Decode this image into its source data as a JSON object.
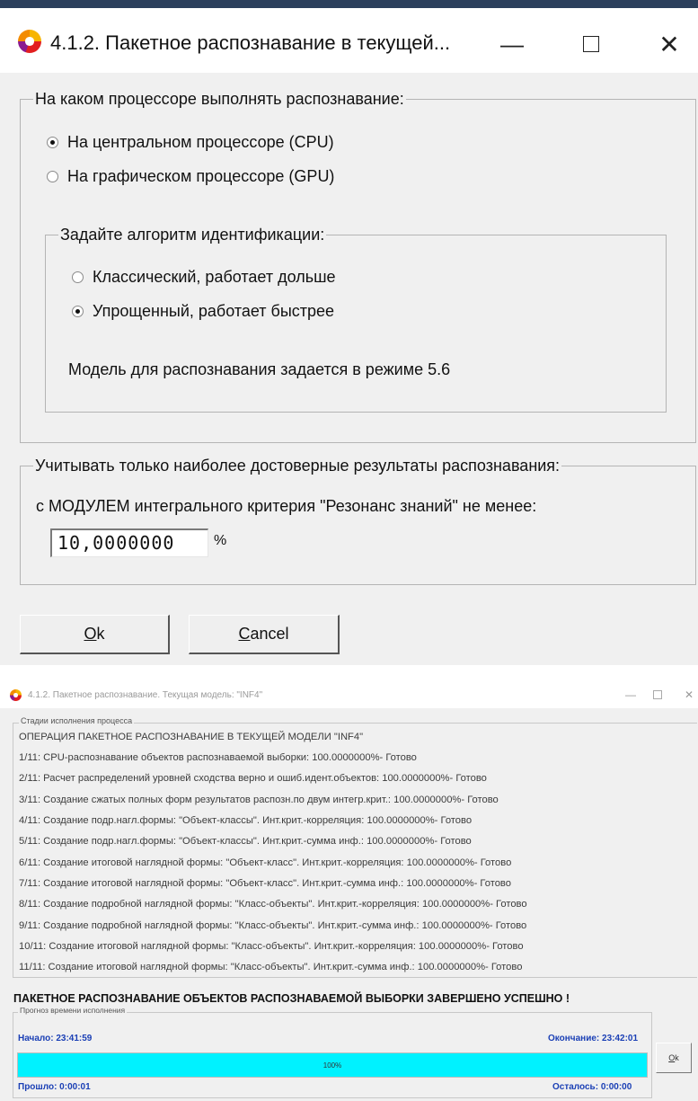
{
  "dialog1": {
    "title": "4.1.2. Пакетное распознавание в текущей...",
    "processor_group": {
      "legend": "На каком процессоре выполнять распознавание:",
      "options": [
        {
          "label": "На центральном процессоре (CPU)",
          "selected": true
        },
        {
          "label": "На графическом процессоре (GPU)",
          "selected": false
        }
      ]
    },
    "algorithm_group": {
      "legend": "Задайте алгоритм идентификации:",
      "options": [
        {
          "label": "Классический, работает дольше",
          "selected": false
        },
        {
          "label": "Упрощенный,  работает быстрее",
          "selected": true
        }
      ],
      "note": "Модель для распознавания задается в режиме 5.6"
    },
    "reliable_group": {
      "legend": "Учитывать только наиболее достоверные результаты распознавания:",
      "text": "с МОДУЛЕМ интегрального критерия \"Резонанс знаний\" не менее:",
      "value": "10,0000000",
      "unit": "%"
    },
    "buttons": {
      "ok_mnemonic": "O",
      "ok_rest": "k",
      "cancel_mnemonic": "C",
      "cancel_rest": "ancel"
    },
    "window_controls": {
      "minimize": "—",
      "close": "✕"
    }
  },
  "dialog2": {
    "title": "4.1.2. Пакетное распознавание. Текущая модель: \"INF4\"",
    "stages_legend": "Стадии исполнения процесса",
    "stages": [
      "ОПЕРАЦИЯ ПАКЕТНОЕ РАСПОЗНАВАНИЕ В ТЕКУЩЕЙ МОДЕЛИ \"INF4\"",
      "1/11: CPU-распознавание объектов распознаваемой выборки: 100.0000000%- Готово",
      "2/11: Расчет распределений уровней сходства верно и ошиб.идент.объектов: 100.0000000%- Готово",
      "3/11: Создание сжатых полных форм результатов распозн.по двум интегр.крит.: 100.0000000%- Готово",
      "4/11: Создание подр.нагл.формы: \"Объект-классы\". Инт.крит.-корреляция: 100.0000000%- Готово",
      "5/11: Создание подр.нагл.формы: \"Объект-классы\". Инт.крит.-сумма инф.: 100.0000000%- Готово",
      "6/11: Создание итоговой наглядной формы: \"Объект-класс\". Инт.крит.-корреляция: 100.0000000%- Готово",
      "7/11: Создание итоговой наглядной формы: \"Объект-класс\". Инт.крит.-сумма инф.: 100.0000000%- Готово",
      "8/11: Создание подробной наглядной формы: \"Класс-объекты\". Инт.крит.-корреляция: 100.0000000%- Готово",
      "9/11: Создание подробной наглядной формы: \"Класс-объекты\". Инт.крит.-сумма инф.: 100.0000000%- Готово",
      "10/11: Создание итоговой наглядной формы: \"Класс-объекты\". Инт.крит.-корреляция: 100.0000000%- Готово",
      "11/11: Создание итоговой наглядной формы: \"Класс-объекты\". Инт.крит.-сумма инф.: 100.0000000%- Готово"
    ],
    "final_message": "ПАКЕТНОЕ РАСПОЗНАВАНИЕ ОБЪЕКТОВ РАСПОЗНАВАЕМОЙ ВЫБОРКИ ЗАВЕРШЕНО УСПЕШНО !",
    "time_legend": "Прогноз времени исполнения",
    "start_label": "Начало: 23:41:59",
    "end_label": "Окончание: 23:42:01",
    "elapsed_label": "Прошло: 0:00:01",
    "remaining_label": "Осталось: 0:00:00",
    "progress": {
      "percent": 100,
      "label": "100%"
    },
    "ok_mnemonic": "O",
    "ok_rest": "k"
  }
}
